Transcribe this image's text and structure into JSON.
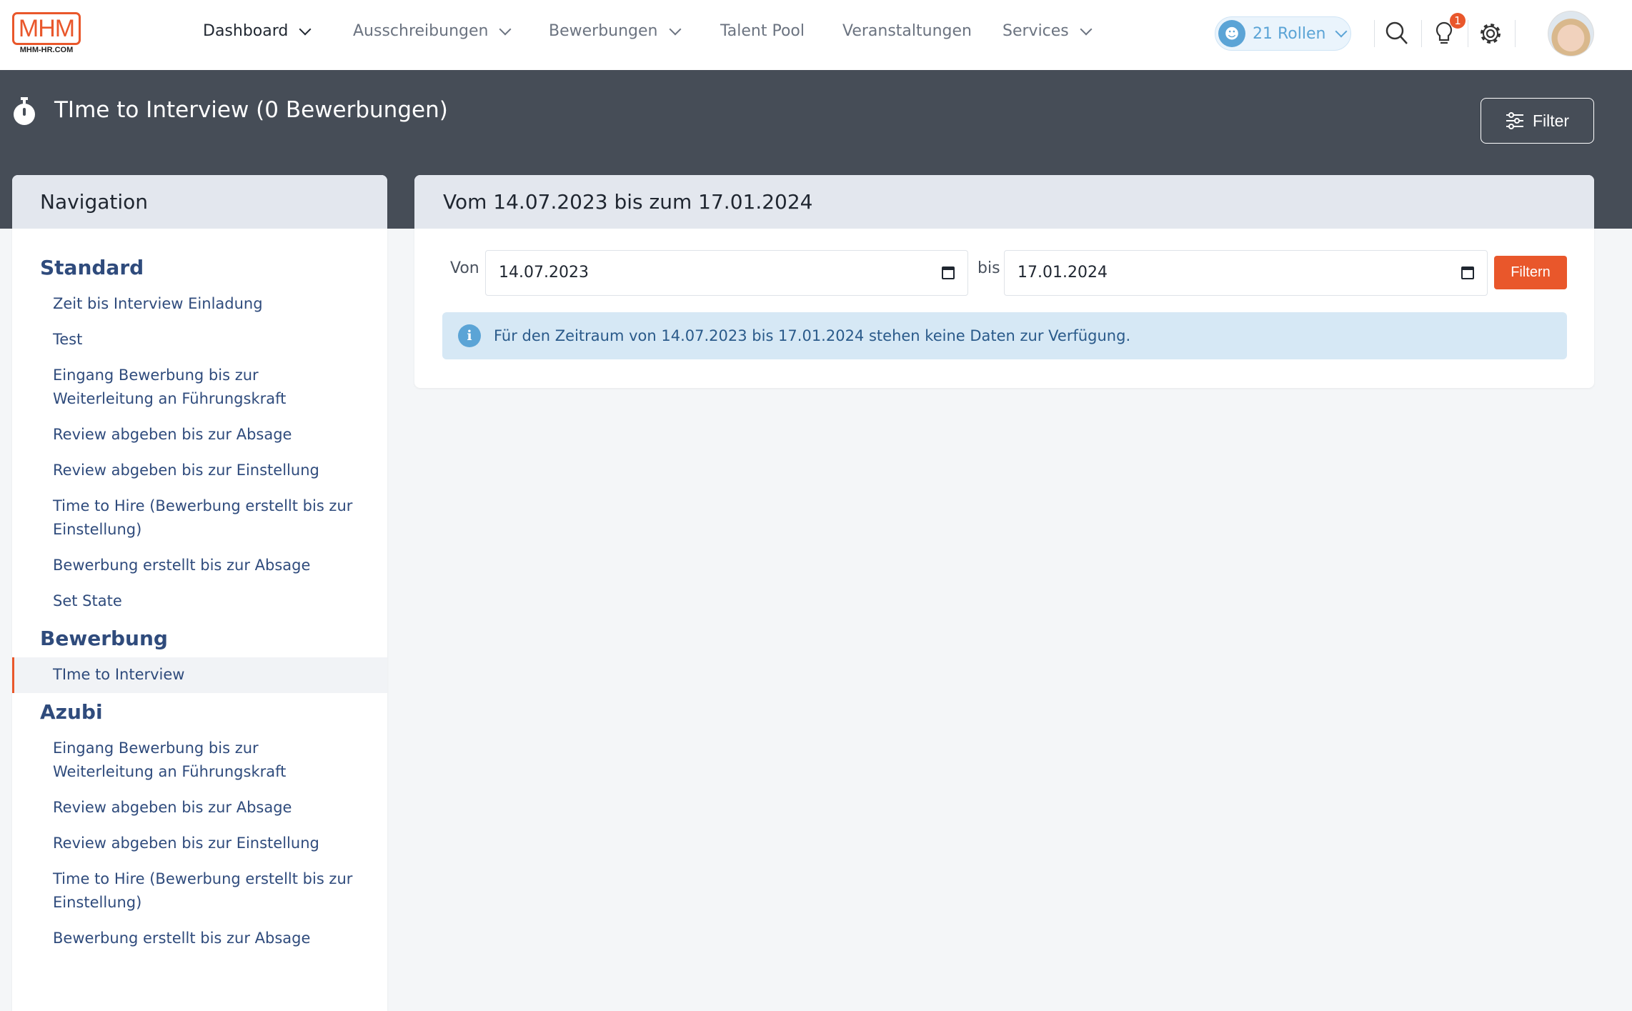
{
  "logo": {
    "text": "MHM",
    "sub": "MHM-HR.COM"
  },
  "topnav": [
    {
      "label": "Dashboard",
      "dropdown": true
    },
    {
      "label": "Ausschreibungen",
      "dropdown": true
    },
    {
      "label": "Bewerbungen",
      "dropdown": true
    },
    {
      "label": "Talent Pool",
      "dropdown": false
    },
    {
      "label": "Veranstaltungen",
      "dropdown": false
    },
    {
      "label": "Services",
      "dropdown": true
    }
  ],
  "roles": {
    "label": "21 Rollen"
  },
  "notifications": {
    "count": "1"
  },
  "page": {
    "title": "TIme to Interview (0 Bewerbungen)",
    "filter_label": "Filter"
  },
  "navigation": {
    "title": "Navigation",
    "sections": [
      {
        "title": "Standard",
        "items": [
          "Zeit bis Interview Einladung",
          "Test",
          "Eingang Bewerbung bis zur Weiterleitung an Führungskraft",
          "Review abgeben bis zur Absage",
          "Review abgeben bis zur Einstellung",
          "Time to Hire (Bewerbung erstellt bis zur Einstellung)",
          "Bewerbung erstellt bis zur Absage",
          "Set State"
        ]
      },
      {
        "title": "Bewerbung",
        "items": [
          "TIme to Interview"
        ]
      },
      {
        "title": "Azubi",
        "items": [
          "Eingang Bewerbung bis zur Weiterleitung an Führungskraft",
          "Review abgeben bis zur Absage",
          "Review abgeben bis zur Einstellung",
          "Time to Hire (Bewerbung erstellt bis zur Einstellung)",
          "Bewerbung erstellt bis zur Absage"
        ]
      }
    ],
    "active": "TIme to Interview"
  },
  "main": {
    "heading": "Vom 14.07.2023 bis zum 17.01.2024",
    "from_label": "Von",
    "from_value": "14.07.2023",
    "to_label": "bis",
    "to_value": "17.01.2024",
    "submit_label": "Filtern",
    "alert": "Für den Zeitraum von 14.07.2023 bis 17.01.2024 stehen keine Daten zur Verfügung."
  },
  "colors": {
    "accent": "#e9572b",
    "band": "#464d57",
    "link": "#2f4b7c",
    "info": "#5ba4d6"
  }
}
